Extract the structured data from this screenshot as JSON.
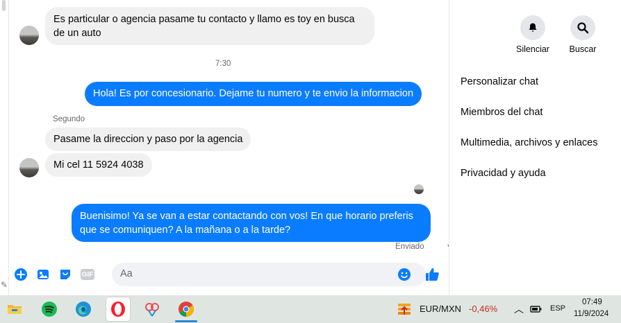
{
  "messages": {
    "msg1": "Es particular o agencia pasame tu contacto y llamo es toy en busca",
    "msg1_line2": "de un auto",
    "time": "7:30",
    "out1": "Hola! Es por concesionario. Dejame tu numero y te envio la informacion",
    "sender": "Segundo",
    "msg2": "Pasame la direccion y paso por la agencia",
    "msg3": "Mi cel 11 5924 4038",
    "out2_line1": "Buenisimo! Ya se van a estar contactando con vos! En que horario preferis",
    "out2_line2": "que se comuniquen? A la mañana o a la tarde?",
    "status": "Enviado"
  },
  "composer": {
    "placeholder": "Aa",
    "icons": [
      "add-icon",
      "photo-icon",
      "sticker-icon",
      "gif-icon",
      "emoji-icon",
      "like-icon"
    ],
    "gif_label": "GIF"
  },
  "panel": {
    "mute_label": "Silenciar",
    "search_label": "Buscar",
    "items": [
      "Personalizar chat",
      "Miembros del chat",
      "Multimedia, archivos y enlaces",
      "Privacidad y ayuda"
    ]
  },
  "taskbar": {
    "currency_pair": "EUR/MXN",
    "currency_change": "-0,46%",
    "language": "ESP",
    "time": "07:49",
    "date": "11/9/2024"
  },
  "colors": {
    "accent": "#0a7cff",
    "negative": "#c42b1c"
  }
}
